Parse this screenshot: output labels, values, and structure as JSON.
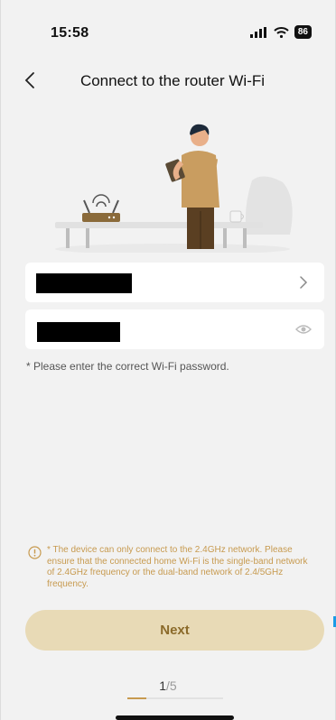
{
  "status_bar": {
    "time": "15:58",
    "battery": "86"
  },
  "header": {
    "title": "Connect to the router Wi-Fi"
  },
  "form": {
    "ssid_value": "",
    "password_value": "",
    "hint": "* Please enter the correct Wi-Fi password."
  },
  "notice": {
    "text": "* The device can only connect to the 2.4GHz network. Please ensure that the connected home Wi-Fi is the single-band network of 2.4GHz frequency or the dual-band network of 2.4/5GHz frequency."
  },
  "next_button": {
    "label": "Next"
  },
  "pager": {
    "current": "1",
    "total": "/5",
    "progress": 0.2
  },
  "colors": {
    "accent": "#c79a4f",
    "button_bg": "#e8dab6",
    "button_text": "#8b6a2a",
    "background": "#f2f2f2"
  },
  "icons": {
    "back": "chevron-left-icon",
    "ssid_select": "chevron-right-icon",
    "password_visibility": "eye-icon",
    "notice": "info-circle-icon"
  }
}
